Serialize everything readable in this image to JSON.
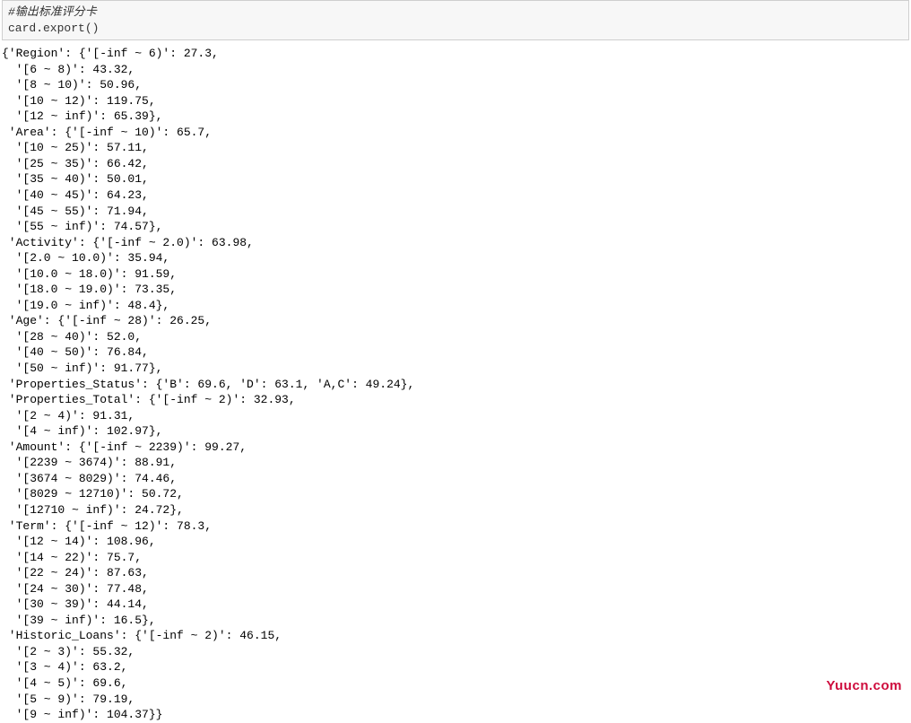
{
  "code_cell": {
    "comment": "#输出标准评分卡",
    "code": "card.export()"
  },
  "output_lines": [
    "{'Region': {'[-inf ~ 6)': 27.3,",
    "  '[6 ~ 8)': 43.32,",
    "  '[8 ~ 10)': 50.96,",
    "  '[10 ~ 12)': 119.75,",
    "  '[12 ~ inf)': 65.39},",
    " 'Area': {'[-inf ~ 10)': 65.7,",
    "  '[10 ~ 25)': 57.11,",
    "  '[25 ~ 35)': 66.42,",
    "  '[35 ~ 40)': 50.01,",
    "  '[40 ~ 45)': 64.23,",
    "  '[45 ~ 55)': 71.94,",
    "  '[55 ~ inf)': 74.57},",
    " 'Activity': {'[-inf ~ 2.0)': 63.98,",
    "  '[2.0 ~ 10.0)': 35.94,",
    "  '[10.0 ~ 18.0)': 91.59,",
    "  '[18.0 ~ 19.0)': 73.35,",
    "  '[19.0 ~ inf)': 48.4},",
    " 'Age': {'[-inf ~ 28)': 26.25,",
    "  '[28 ~ 40)': 52.0,",
    "  '[40 ~ 50)': 76.84,",
    "  '[50 ~ inf)': 91.77},",
    " 'Properties_Status': {'B': 69.6, 'D': 63.1, 'A,C': 49.24},",
    " 'Properties_Total': {'[-inf ~ 2)': 32.93,",
    "  '[2 ~ 4)': 91.31,",
    "  '[4 ~ inf)': 102.97},",
    " 'Amount': {'[-inf ~ 2239)': 99.27,",
    "  '[2239 ~ 3674)': 88.91,",
    "  '[3674 ~ 8029)': 74.46,",
    "  '[8029 ~ 12710)': 50.72,",
    "  '[12710 ~ inf)': 24.72},",
    " 'Term': {'[-inf ~ 12)': 78.3,",
    "  '[12 ~ 14)': 108.96,",
    "  '[14 ~ 22)': 75.7,",
    "  '[22 ~ 24)': 87.63,",
    "  '[24 ~ 30)': 77.48,",
    "  '[30 ~ 39)': 44.14,",
    "  '[39 ~ inf)': 16.5},",
    " 'Historic_Loans': {'[-inf ~ 2)': 46.15,",
    "  '[2 ~ 3)': 55.32,",
    "  '[3 ~ 4)': 63.2,",
    "  '[4 ~ 5)': 69.6,",
    "  '[5 ~ 9)': 79.19,",
    "  '[9 ~ inf)': 104.37}}"
  ],
  "watermark": "Yuucn.com"
}
